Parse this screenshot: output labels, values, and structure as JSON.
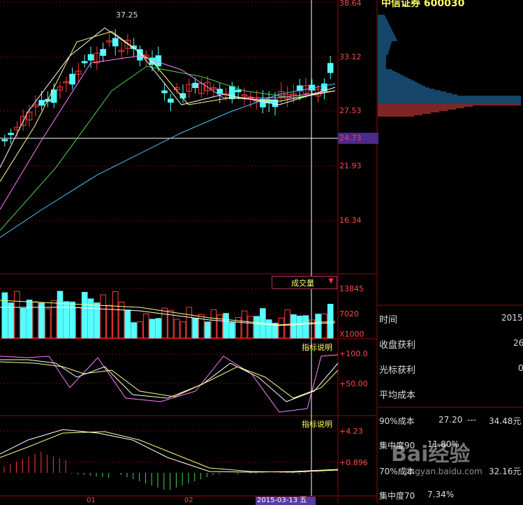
{
  "header": {
    "stock_title": "中信证券 600030"
  },
  "price_axis": {
    "labels": [
      "38.64",
      "33.12",
      "27.53",
      "21.93",
      "16.34"
    ],
    "high_mark": "37.25",
    "cursor_price": "24.73"
  },
  "volume_panel": {
    "indicator": "成交量",
    "labels": [
      "13845",
      "7020"
    ],
    "unit": "X1000"
  },
  "kdj_panel": {
    "tag": "指标说明",
    "labels": [
      "+100.0",
      "+50.00"
    ]
  },
  "macd_panel": {
    "tag": "指标说明",
    "labels": [
      "+4.23",
      "+0.896"
    ]
  },
  "time_axis": {
    "months": [
      "01",
      "02"
    ],
    "cursor_date": "2015-03-13 五"
  },
  "side_panel": {
    "rows": [
      {
        "label": "时间",
        "value": "2015"
      },
      {
        "label": "收盘获利",
        "value": "26"
      },
      {
        "label": "光标获利",
        "value": "0"
      },
      {
        "label": "平均成本",
        "value": ""
      }
    ],
    "cost90": {
      "label": "90%成本",
      "v1": "27.20",
      "v2": "34.48元"
    },
    "conc90": {
      "label": "集中度90",
      "v": "11.80%"
    },
    "cost70": {
      "label": "70%成本",
      "v1": "",
      "v2": "32.16元"
    },
    "conc70": {
      "label": "集中度70",
      "v": "7.34%"
    }
  },
  "watermark": {
    "text": "Bai经验",
    "sub": "jingyan.baidu.com"
  },
  "colors": {
    "up": "#ff3a3a",
    "down": "#54ffff",
    "grid": "#7a0000",
    "panel_border": "#a00000"
  }
}
